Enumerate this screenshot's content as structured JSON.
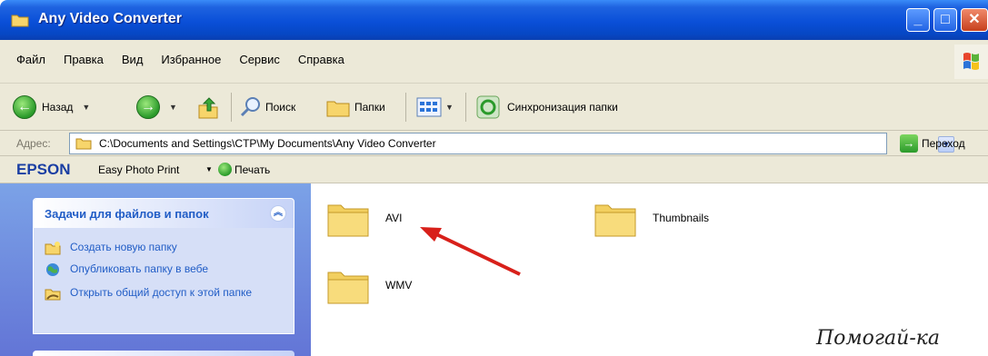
{
  "window": {
    "title": "Any Video Converter"
  },
  "menu": [
    "Файл",
    "Правка",
    "Вид",
    "Избранное",
    "Сервис",
    "Справка"
  ],
  "toolbar": {
    "back_label": "Назад",
    "search_label": "Поиск",
    "folders_label": "Папки",
    "sync_label": "Синхронизация папки"
  },
  "address": {
    "label": "Адрес:",
    "path": "C:\\Documents and Settings\\CTP\\My Documents\\Any Video Converter",
    "go_label": "Переход"
  },
  "epson": {
    "brand": "EPSON",
    "easy_label": "Easy Photo Print",
    "print_label": "Печать"
  },
  "tasks": {
    "header": "Задачи для файлов и папок",
    "items": [
      "Создать новую папку",
      "Опубликовать папку в вебе",
      "Открыть общий доступ к этой папке"
    ]
  },
  "files": [
    "AVI",
    "Thumbnails",
    "WMV"
  ],
  "watermark": "Помогай-ка",
  "colors": {
    "title_blue": "#0a4fd8",
    "task_blue": "#215dc6",
    "arrow_red": "#d8201a"
  }
}
